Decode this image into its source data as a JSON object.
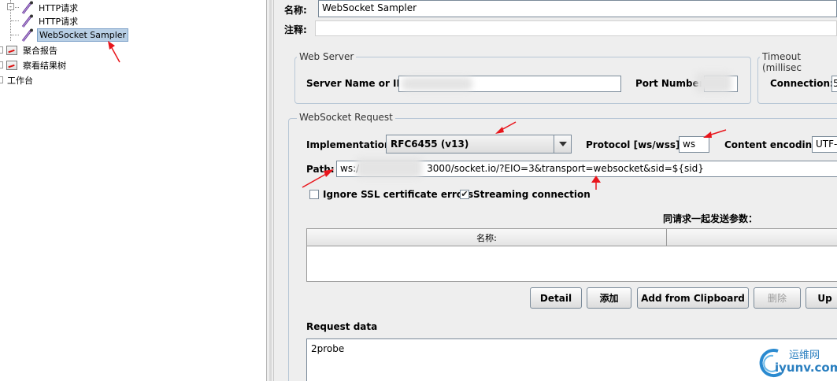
{
  "tree": {
    "items": [
      {
        "label": "HTTP请求",
        "icon": "sampler-icon"
      },
      {
        "label": "HTTP请求",
        "icon": "sampler-icon"
      },
      {
        "label": "WebSocket Sampler",
        "icon": "sampler-icon",
        "selected": true
      },
      {
        "label": "聚合报告",
        "icon": "report-icon"
      },
      {
        "label": "察看结果树",
        "icon": "report-icon"
      },
      {
        "label": "工作台",
        "icon": ""
      }
    ]
  },
  "sampler": {
    "name_label": "名称:",
    "name_value": "WebSocket Sampler",
    "comment_label": "注释:",
    "comment_value": ""
  },
  "web_server": {
    "title": "Web Server",
    "server_label": "Server Name or IP:",
    "port_label": "Port Number:"
  },
  "timeout": {
    "title": "Timeout (millisec",
    "connection_label": "Connection:",
    "connection_value": "5"
  },
  "ws_request": {
    "title": "WebSocket Request",
    "implementation_label": "Implementation:",
    "implementation_value": "RFC6455 (v13)",
    "protocol_label": "Protocol [ws/wss]:",
    "protocol_value": "ws",
    "encoding_label": "Content encoding:",
    "encoding_value": "UTF-",
    "path_label": "Path:",
    "path_prefix": "ws:/",
    "path_value": "3000/socket.io/?EIO=3&transport=websocket&sid=${sid}",
    "ignore_ssl_label": "Ignore SSL certificate errors",
    "ignore_ssl_checked": false,
    "streaming_label": "Streaming connection",
    "streaming_checked": true,
    "params_title": "同请求一起发送参数：",
    "params_col_name": "名称:",
    "params_col_value": ""
  },
  "buttons": {
    "detail": "Detail",
    "add": "添加",
    "add_clipboard": "Add from Clipboard",
    "delete": "删除",
    "up": "Up"
  },
  "request_data": {
    "label": "Request data",
    "value": "2probe"
  },
  "watermark": {
    "line1": "运维网",
    "line2": "iyunv.com"
  },
  "colors": {
    "panel_bg": "#eeeeee",
    "selection": "#b8cfe5",
    "annotation_arrow": "#e8151b"
  }
}
